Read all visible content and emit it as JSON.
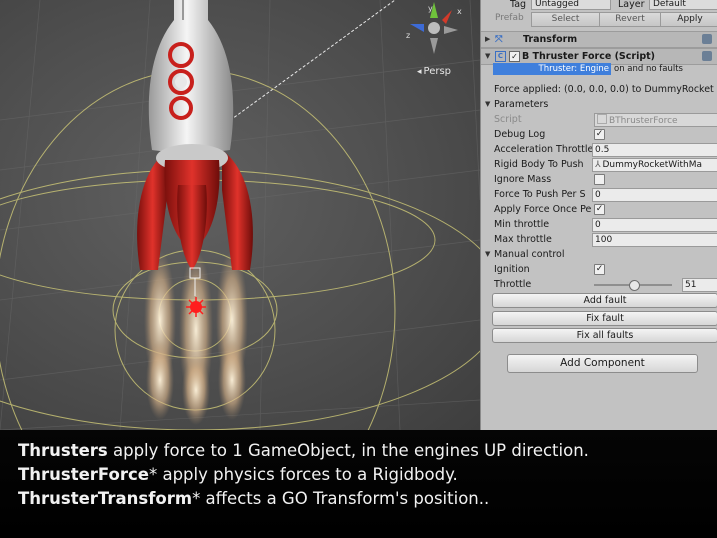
{
  "scene": {
    "view_label": "Persp"
  },
  "inspector": {
    "top": {
      "tag_label": "Tag",
      "tag_value": "Untagged",
      "layer_label": "Layer",
      "layer_value": "Default",
      "prefab_label": "Prefab",
      "select_label": "Select",
      "revert_label": "Revert",
      "apply_label": "Apply"
    },
    "transform": {
      "title": "Transform"
    },
    "component": {
      "title": "B Thruster Force (Script)",
      "status": "Thruster: Engine on and no faults",
      "status_part1": "Thruster: Engine",
      "status_part2": "on and no faults",
      "force_text": "Force applied: (0.0, 0.0, 0.0) to DummyRocket"
    },
    "parameters": {
      "header": "Parameters",
      "script_label": "Script",
      "script_value": "BThrusterForce",
      "debug_log_label": "Debug Log",
      "debug_log_checked": true,
      "accel_label": "Acceleration Throttle",
      "accel_value": "0.5",
      "rigid_label": "Rigid Body To Push",
      "rigid_value": "DummyRocketWithMa",
      "ignore_mass_label": "Ignore Mass",
      "ignore_mass_checked": false,
      "force_push_label": "Force To Push Per S",
      "force_push_value": "0",
      "apply_once_label": "Apply Force Once Pe",
      "apply_once_checked": true,
      "min_throttle_label": "Min throttle",
      "min_throttle_value": "0",
      "max_throttle_label": "Max throttle",
      "max_throttle_value": "100"
    },
    "manual": {
      "header": "Manual control",
      "ignition_label": "Ignition",
      "ignition_checked": true,
      "throttle_label": "Throttle",
      "throttle_value": "51"
    },
    "buttons": {
      "add_fault": "Add fault",
      "fix_fault": "Fix fault",
      "fix_all": "Fix all faults",
      "add_component": "Add Component"
    }
  },
  "caption": {
    "line1_bold": "Thrusters",
    "line1_rest": " apply force to 1 GameObject, in the engines UP direction.",
    "line2_bold": "ThrusterForce",
    "line2_rest": "* apply physics forces to a Rigidbody.",
    "line3_bold": "ThrusterTransform",
    "line3_rest": "* affects a GO Transform's position.."
  },
  "colors": {
    "rocket_red": "#c8201c",
    "rocket_white": "#e8e8e8",
    "inspector_bg": "#c2c2c2",
    "status_blue": "#3f7fdc",
    "gizmo_yellow": "#d8d27a"
  }
}
